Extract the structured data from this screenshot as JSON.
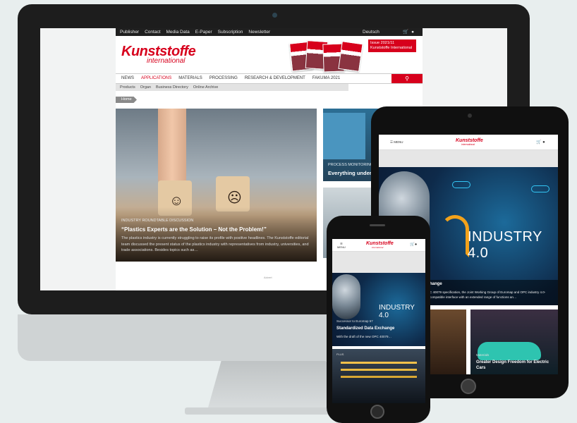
{
  "desktop": {
    "topbar": {
      "links": [
        "Publisher",
        "Contact",
        "Media Data",
        "E-Paper",
        "Subscription",
        "Newsletter"
      ],
      "language": "Deutsch",
      "icons": [
        "cart-icon",
        "user-icon"
      ]
    },
    "logo": {
      "main": "Kunststoffe",
      "sub": "international"
    },
    "issue_label": "Issue 2021/11 Kunststoffe International",
    "nav": {
      "items": [
        "NEWS",
        "APPLICATIONS",
        "MATERIALS",
        "PROCESSING",
        "RESEARCH & DEVELOPMENT",
        "FAKUMA 2021"
      ],
      "active_index": 1,
      "search_icon": "search-icon"
    },
    "subnav": [
      "Products",
      "Organ",
      "Business Directory",
      "Online Archive"
    ],
    "breadcrumb": "Home",
    "hero": {
      "kicker": "INDUSTRY ROUNDTABLE DISCUSSION",
      "title": "“Plastics Experts are the Solution – Not the Problem!”",
      "teaser": "The plastics industry is currently struggling to raise its profile with positive headlines. The Kunststoffe editorial team discussed the present status of the plastics industry with representatives from industry, universities, and trade associations. Besides topics such as…"
    },
    "side_card": {
      "kicker": "PROCESS MONITORING",
      "title": "Everything under"
    },
    "ad_label": "Advert"
  },
  "tablet": {
    "menu_label": "MENU",
    "logo": {
      "main": "Kunststoffe",
      "sub": "international"
    },
    "icons": [
      "cart-icon",
      "user-icon"
    ],
    "hero": {
      "overlay_text": "INDUSTRY 4.0",
      "title": "hange",
      "text": "C 40079 specification, the Joint Working Group of Euromap and OPC industry 4.0-compatible interface with an extended range of functions an…"
    },
    "card": {
      "kicker": "Materials",
      "title": "Greater Design Freedom for Electric Cars"
    }
  },
  "phone": {
    "menu_label": "MENU",
    "logo": {
      "main": "Kunststoffe",
      "sub": "international"
    },
    "icons": [
      "cart-icon",
      "user-icon"
    ],
    "hero": {
      "overlay_text": "INDUSTRY 4.0",
      "kicker": "Successor to Euromap 67",
      "title": "Standardized Data Exchange",
      "text": "With the draft of the new OPC 40079…"
    },
    "card": {
      "kicker": "PLUS"
    }
  },
  "colors": {
    "brand_red": "#d7001c",
    "device_black": "#111111",
    "background": "#e8eeee"
  }
}
